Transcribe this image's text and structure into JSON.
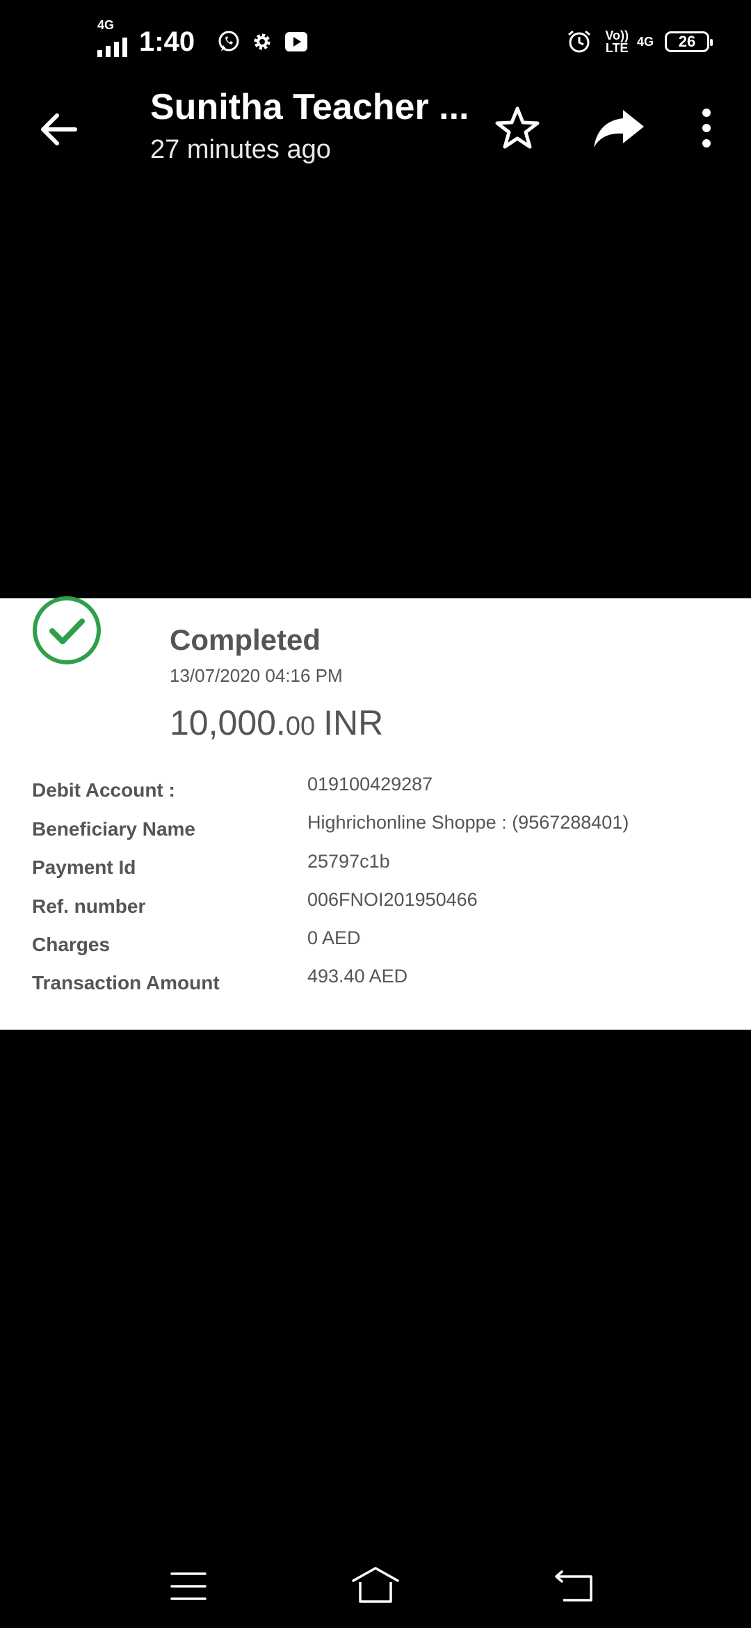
{
  "status_bar": {
    "network_label": "4G",
    "time": "1:40",
    "volte_top": "Vo))",
    "volte_bottom": "LTE",
    "network_right": "4G",
    "battery": "26"
  },
  "header": {
    "title": "Sunitha Teacher ...",
    "subtitle": "27 minutes ago"
  },
  "receipt": {
    "status": "Completed",
    "datetime": "13/07/2020 04:16 PM",
    "amount_whole": "10,000.",
    "amount_decimal": "00",
    "amount_currency": "INR",
    "rows": [
      {
        "label": "Debit Account :",
        "value": "019100429287"
      },
      {
        "label": "Beneficiary Name",
        "value": "Highrichonline Shoppe : (9567288401)"
      },
      {
        "label": "Payment Id",
        "value": "25797c1b"
      },
      {
        "label": "Ref. number",
        "value": "006FNOI201950466"
      },
      {
        "label": "Charges",
        "value": "0 AED"
      },
      {
        "label": "Transaction Amount",
        "value": "493.40 AED"
      }
    ]
  },
  "colors": {
    "background": "#000000",
    "receipt_text": "#555555",
    "success_green": "#2fa04a"
  },
  "icons": {
    "back": "arrow-left-icon",
    "star": "star-icon",
    "share": "share-icon",
    "more": "more-vertical-icon",
    "check": "check-circle-icon",
    "nav_menu": "menu-icon",
    "nav_home": "home-icon",
    "nav_back": "back-icon"
  }
}
